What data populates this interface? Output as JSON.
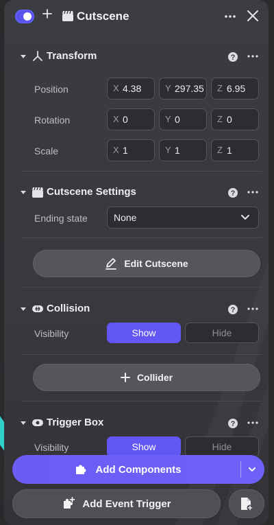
{
  "header": {
    "title": "Cutscene",
    "enabled": true,
    "icons": [
      "toggle",
      "plus-icon",
      "clapperboard-icon",
      "more-icon",
      "close-icon"
    ]
  },
  "transform": {
    "title": "Transform",
    "rows": [
      {
        "label": "Position",
        "x": "4.38",
        "y": "297.35",
        "z": "6.95"
      },
      {
        "label": "Rotation",
        "x": "0",
        "y": "0",
        "z": "0"
      },
      {
        "label": "Scale",
        "x": "1",
        "y": "1",
        "z": "1"
      }
    ],
    "axes": {
      "x": "X",
      "y": "Y",
      "z": "Z"
    }
  },
  "cutscene_settings": {
    "title": "Cutscene Settings",
    "ending_state_label": "Ending state",
    "ending_state_value": "None",
    "edit_button": "Edit Cutscene"
  },
  "collision": {
    "title": "Collision",
    "visibility_label": "Visibility",
    "show": "Show",
    "hide": "Hide",
    "selected": "Show",
    "collider_button": "Collider"
  },
  "trigger_box": {
    "title": "Trigger Box",
    "visibility_label": "Visibility",
    "show": "Show",
    "hide": "Hide",
    "selected": "Show"
  },
  "footer": {
    "add_components": "Add Components",
    "add_event_trigger": "Add Event Trigger"
  },
  "colors": {
    "accent": "#6256f5",
    "panel": "#3b3b40",
    "field": "#2c2c31"
  }
}
